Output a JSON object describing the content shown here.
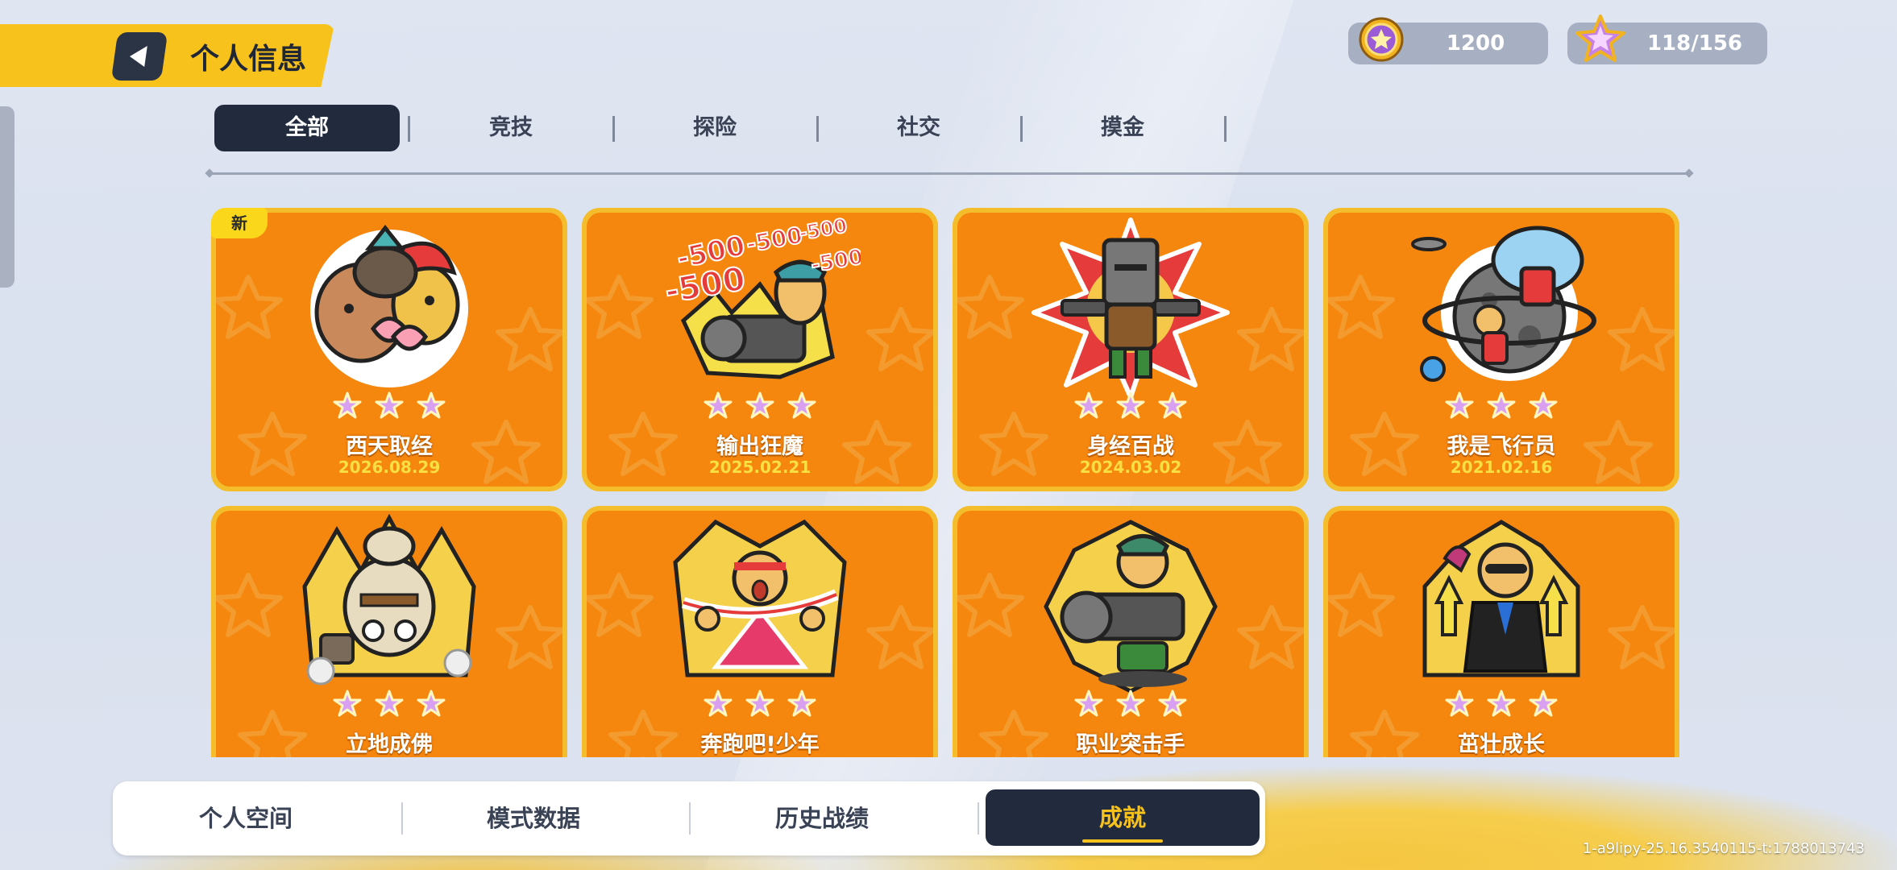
{
  "header": {
    "title": "个人信息"
  },
  "currency": {
    "coins": "1200",
    "stars": "118/156"
  },
  "tabs": [
    {
      "label": "全部",
      "active": true
    },
    {
      "label": "竞技",
      "active": false
    },
    {
      "label": "探险",
      "active": false
    },
    {
      "label": "社交",
      "active": false
    },
    {
      "label": "摸金",
      "active": false
    }
  ],
  "achievements": [
    {
      "name": "西天取经",
      "date": "2026.08.29",
      "stars": 3,
      "badge": "新",
      "icon": "pilgrim-team-icon"
    },
    {
      "name": "输出狂魔",
      "date": "2025.02.21",
      "stars": 3,
      "icon": "gatling-damage-icon",
      "damage_text": "-500"
    },
    {
      "name": "身经百战",
      "date": "2024.03.02",
      "stars": 3,
      "icon": "bucket-warrior-icon"
    },
    {
      "name": "我是飞行员",
      "date": "2021.02.16",
      "stars": 3,
      "icon": "astronaut-planet-icon"
    },
    {
      "name": "立地成佛",
      "date": "",
      "stars": 3,
      "icon": "robot-buddha-icon"
    },
    {
      "name": "奔跑吧!少年",
      "date": "",
      "stars": 3,
      "icon": "runner-finish-icon"
    },
    {
      "name": "职业突击手",
      "date": "",
      "stars": 3,
      "icon": "assault-gunner-icon"
    },
    {
      "name": "茁壮成长",
      "date": "",
      "stars": 3,
      "icon": "growing-tuxedo-icon"
    }
  ],
  "bottom_nav": [
    {
      "label": "个人空间",
      "active": false
    },
    {
      "label": "模式数据",
      "active": false
    },
    {
      "label": "历史战绩",
      "active": false
    },
    {
      "label": "成就",
      "active": true
    }
  ],
  "build_id": "1-a9lipy-25.16.3540115-t:1788013743",
  "colors": {
    "accent": "#f7c21b",
    "card": "#f6870e",
    "dark": "#222b3d"
  }
}
